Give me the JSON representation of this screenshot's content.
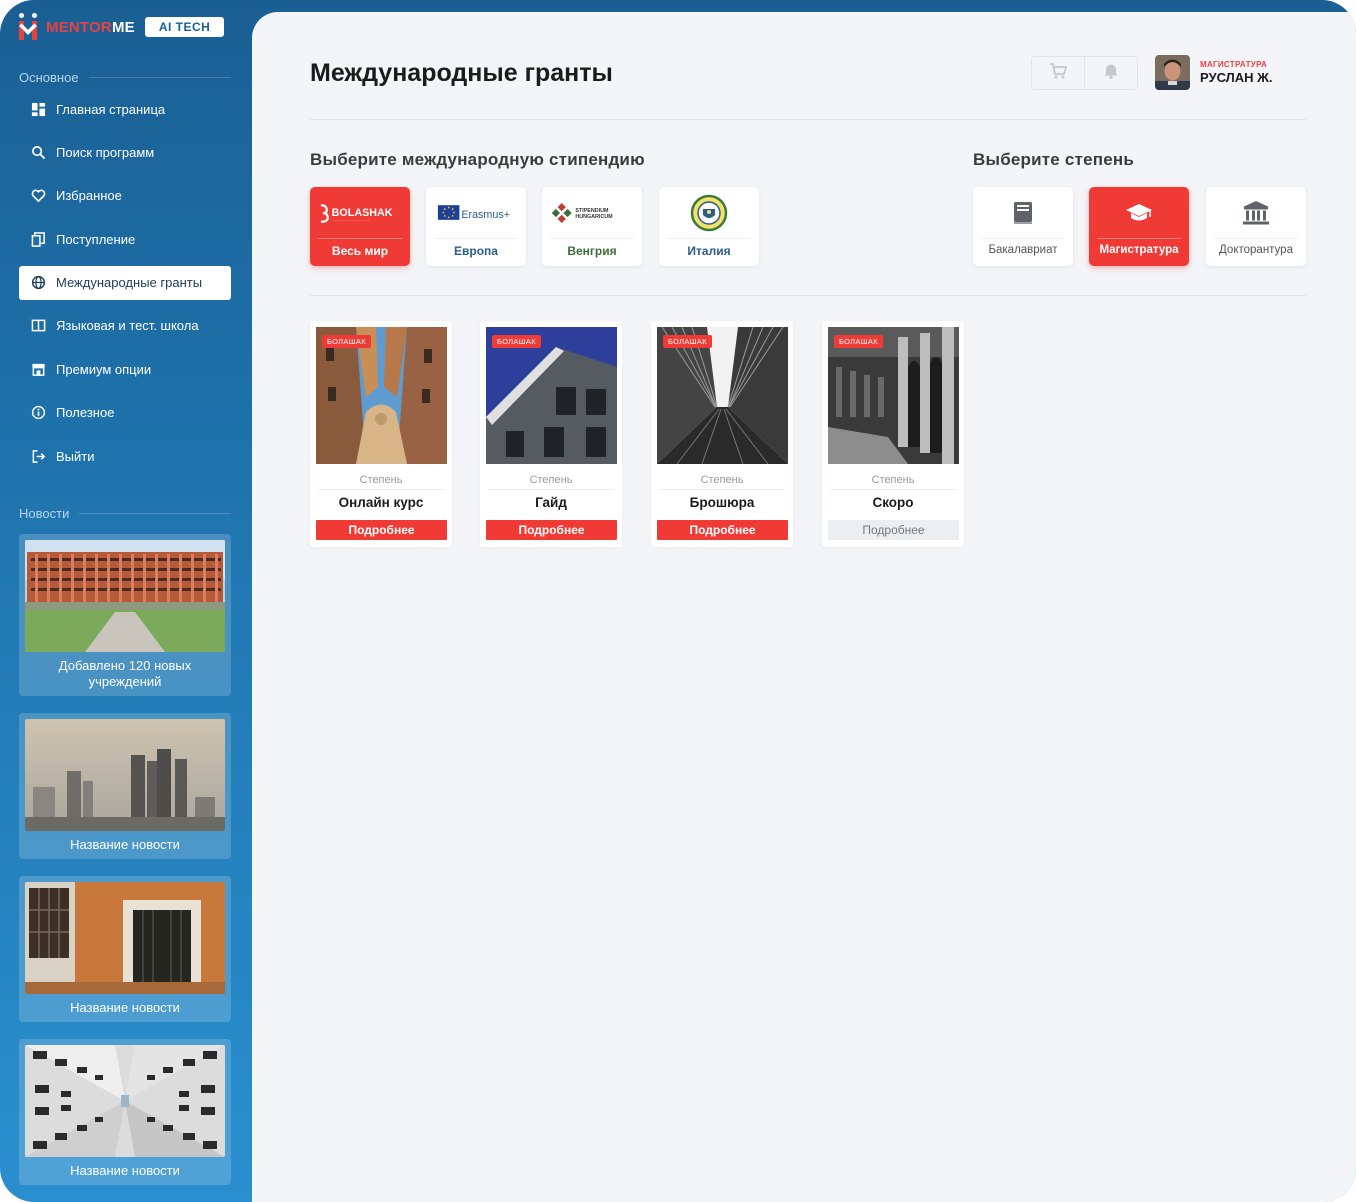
{
  "brand": {
    "name_part1": "MENTOR",
    "name_part2": "ME",
    "badge": "AI TECH"
  },
  "sidebar": {
    "section_main": "Основное",
    "items": [
      {
        "label": "Главная страница",
        "icon": "dashboard-icon"
      },
      {
        "label": "Поиск программ",
        "icon": "search-icon"
      },
      {
        "label": "Избранное",
        "icon": "heart-icon"
      },
      {
        "label": "Поступление",
        "icon": "documents-icon"
      },
      {
        "label": "Международные гранты",
        "icon": "globe-icon",
        "active": true
      },
      {
        "label": "Языковая и тест. школа",
        "icon": "book-open-icon"
      },
      {
        "label": "Премиум опции",
        "icon": "store-icon"
      },
      {
        "label": "Полезное",
        "icon": "info-icon"
      },
      {
        "label": "Выйти",
        "icon": "logout-icon"
      }
    ],
    "section_news": "Новости",
    "news": [
      {
        "caption": "Добавлено 120 новых учреждений",
        "image": "campus-building-photo"
      },
      {
        "caption": "Название новости",
        "image": "skyscrapers-photo"
      },
      {
        "caption": "Название новости",
        "image": "orange-wall-door-photo"
      },
      {
        "caption": "Название новости",
        "image": "building-facade-photo"
      }
    ]
  },
  "header": {
    "title": "Международные гранты",
    "cart_icon": "cart-icon",
    "bell_icon": "bell-icon",
    "user": {
      "role": "МАГИСТРАТУРА",
      "name": "РУСЛАН Ж."
    }
  },
  "scholarships": {
    "title": "Выберите международную стипендию",
    "items": [
      {
        "label": "Весь мир",
        "logo_text": "BOLASHAK",
        "active": true
      },
      {
        "label": "Европа",
        "logo_text": "Erasmus+"
      },
      {
        "label": "Венгрия",
        "logo_text_1": "STIPENDIUM",
        "logo_text_2": "HUNGARICUM"
      },
      {
        "label": "Италия"
      }
    ]
  },
  "degrees": {
    "title": "Выберите степень",
    "items": [
      {
        "label": "Бакалавриат",
        "icon": "book-icon"
      },
      {
        "label": "Магистратура",
        "icon": "graduation-cap-icon",
        "active": true
      },
      {
        "label": "Докторантура",
        "icon": "institution-icon"
      }
    ]
  },
  "cards": [
    {
      "tag": "БОЛАШАК",
      "degree_label": "Степень",
      "title": "Онлайн курс",
      "button": "Подробнее",
      "enabled": true
    },
    {
      "tag": "БОЛАШАК",
      "degree_label": "Степень",
      "title": "Гайд",
      "button": "Подробнее",
      "enabled": true
    },
    {
      "tag": "БОЛАШАК",
      "degree_label": "Степень",
      "title": "Брошюра",
      "button": "Подробнее",
      "enabled": true
    },
    {
      "tag": "БОЛАШАК",
      "degree_label": "Степень",
      "title": "Скоро",
      "button": "Подробнее",
      "enabled": false
    }
  ],
  "colors": {
    "accent": "#f03a35",
    "sidebar": "#1f74ad",
    "background": "#f4f5f8"
  }
}
